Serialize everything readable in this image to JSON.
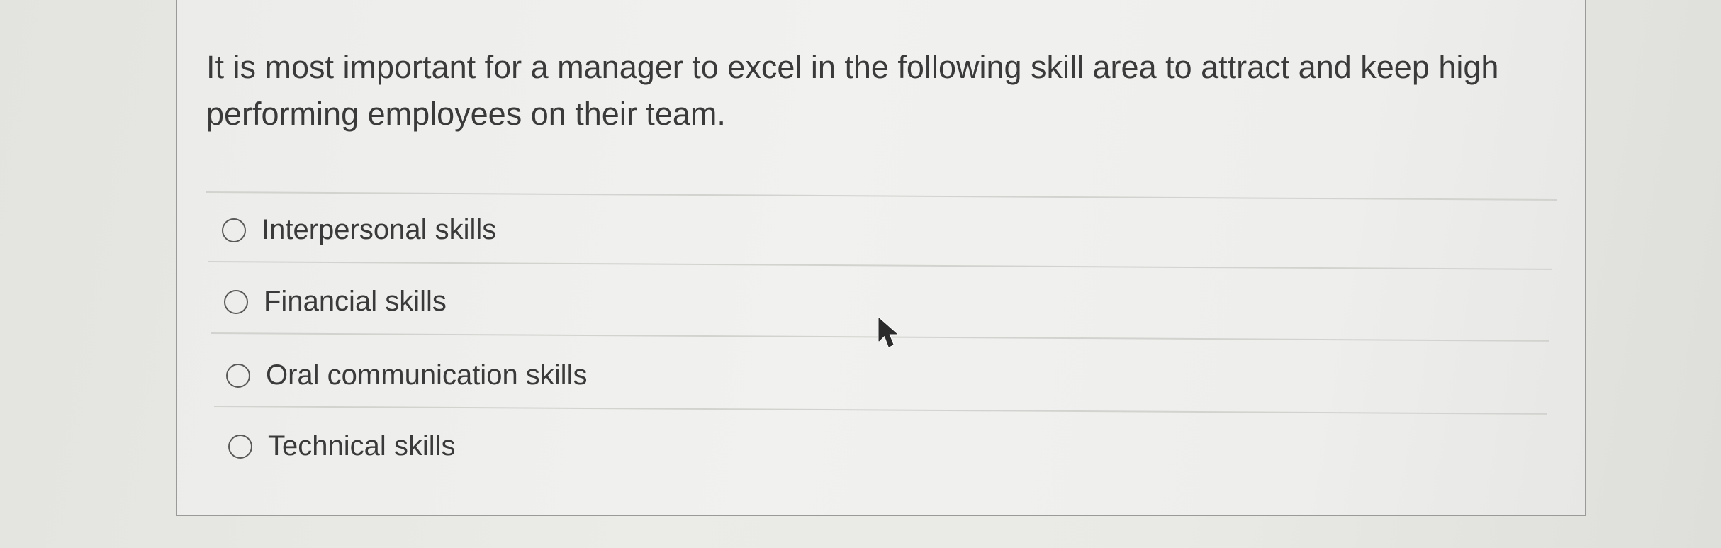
{
  "question": {
    "text": "It is most important for a manager to excel in the following skill area to attract and keep high performing employees on their team."
  },
  "options": [
    {
      "label": "Interpersonal skills",
      "selected": false
    },
    {
      "label": "Financial skills",
      "selected": false
    },
    {
      "label": "Oral communication skills",
      "selected": false
    },
    {
      "label": "Technical skills",
      "selected": false
    }
  ],
  "icons": {
    "cursor": "mouse-pointer-arrow",
    "radio": "radio-button-unselected"
  }
}
